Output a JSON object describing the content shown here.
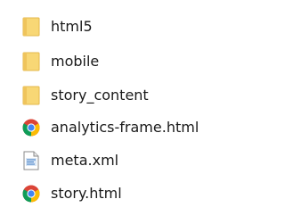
{
  "files": [
    {
      "name": "html5",
      "type": "folder",
      "icon": "folder-icon"
    },
    {
      "name": "mobile",
      "type": "folder",
      "icon": "folder-icon"
    },
    {
      "name": "story_content",
      "type": "folder",
      "icon": "folder-icon"
    },
    {
      "name": "analytics-frame.html",
      "type": "html",
      "icon": "chrome-icon"
    },
    {
      "name": "meta.xml",
      "type": "xml",
      "icon": "xml-file-icon"
    },
    {
      "name": "story.html",
      "type": "html",
      "icon": "chrome-icon"
    }
  ],
  "colors": {
    "folder": "#f7d57a",
    "folder_dark": "#e8b84a",
    "text": "#1a1a1a"
  }
}
